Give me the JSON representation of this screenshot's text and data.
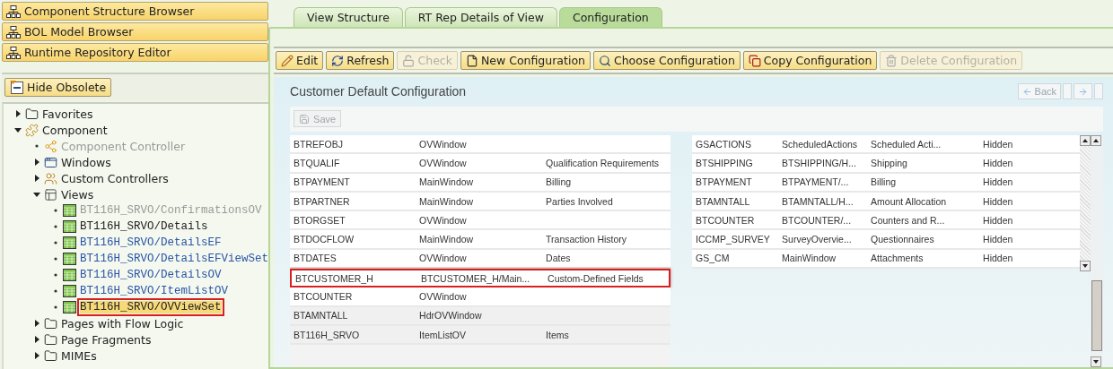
{
  "nav_buttons": [
    {
      "label": "Component Structure Browser"
    },
    {
      "label": "BOL Model Browser"
    },
    {
      "label": "Runtime Repository Editor"
    }
  ],
  "hide_obsolete": {
    "label": "Hide Obsolete"
  },
  "tree": [
    {
      "label": "Favorites",
      "kind": "folder",
      "expanded": false
    },
    {
      "label": "Component",
      "kind": "component",
      "expanded": true,
      "children": [
        {
          "label": "Component Controller",
          "kind": "controller",
          "disabled": true
        },
        {
          "label": "Windows",
          "kind": "windows",
          "expanded": false
        },
        {
          "label": "Custom Controllers",
          "kind": "custom",
          "expanded": false
        },
        {
          "label": "Views",
          "kind": "views",
          "expanded": true,
          "children": [
            {
              "label": "BT116H_SRVO/ConfirmationsOV",
              "kind": "view",
              "disabled": true,
              "link": false,
              "selected": false
            },
            {
              "label": "BT116H_SRVO/Details",
              "kind": "view",
              "disabled": false,
              "link": false,
              "selected": false
            },
            {
              "label": "BT116H_SRVO/DetailsEF",
              "kind": "view",
              "disabled": false,
              "link": true,
              "selected": false
            },
            {
              "label": "BT116H_SRVO/DetailsEFViewSet",
              "kind": "view",
              "disabled": false,
              "link": true,
              "selected": false
            },
            {
              "label": "BT116H_SRVO/DetailsOV",
              "kind": "view",
              "disabled": false,
              "link": true,
              "selected": false
            },
            {
              "label": "BT116H_SRVO/ItemListOV",
              "kind": "view",
              "disabled": false,
              "link": true,
              "selected": false
            },
            {
              "label": "BT116H_SRVO/OVViewSet",
              "kind": "view",
              "disabled": false,
              "link": false,
              "selected": true
            }
          ]
        },
        {
          "label": "Pages with Flow Logic",
          "kind": "folder",
          "expanded": false
        },
        {
          "label": "Page Fragments",
          "kind": "folder",
          "expanded": false
        },
        {
          "label": "MIMEs",
          "kind": "folder",
          "expanded": false
        }
      ]
    }
  ],
  "tabs": [
    {
      "label": "View Structure",
      "selected": false
    },
    {
      "label": "RT Rep Details of View",
      "selected": false
    },
    {
      "label": "Configuration",
      "selected": true
    }
  ],
  "toolbar": [
    {
      "label": "Edit",
      "kind": "edit",
      "disabled": false
    },
    {
      "label": "Refresh",
      "kind": "refresh",
      "disabled": false
    },
    {
      "label": "Check",
      "kind": "check",
      "disabled": true
    },
    {
      "label": "New Configuration",
      "kind": "new",
      "disabled": false
    },
    {
      "label": "Choose Configuration",
      "kind": "choose",
      "disabled": false
    },
    {
      "label": "Copy Configuration",
      "kind": "copy",
      "disabled": false
    },
    {
      "label": "Delete Configuration",
      "kind": "delete",
      "disabled": true
    }
  ],
  "config_title": "Customer Default Configuration",
  "history": {
    "back": "Back"
  },
  "save": {
    "label": "Save",
    "disabled": true
  },
  "left_table": {
    "rows": [
      {
        "cells": [
          "BTREFOBJ",
          "OVWindow",
          ""
        ],
        "highlighted": false
      },
      {
        "cells": [
          "BTQUALIF",
          "OVWindow",
          "Qualification Requirements"
        ],
        "highlighted": false
      },
      {
        "cells": [
          "BTPAYMENT",
          "MainWindow",
          "Billing"
        ],
        "highlighted": false
      },
      {
        "cells": [
          "BTPARTNER",
          "MainWindow",
          "Parties Involved"
        ],
        "highlighted": false
      },
      {
        "cells": [
          "BTORGSET",
          "OVWindow",
          ""
        ],
        "highlighted": false
      },
      {
        "cells": [
          "BTDOCFLOW",
          "MainWindow",
          "Transaction History"
        ],
        "highlighted": false
      },
      {
        "cells": [
          "BTDATES",
          "OVWindow",
          "Dates"
        ],
        "highlighted": false
      },
      {
        "cells": [
          "BTCUSTOMER_H",
          "BTCUSTOMER_H/Main...",
          "Custom-Defined Fields"
        ],
        "highlighted": true
      },
      {
        "cells": [
          "BTCOUNTER",
          "OVWindow",
          ""
        ],
        "highlighted": false
      },
      {
        "cells": [
          "BTAMNTALL",
          "HdrOVWindow",
          ""
        ],
        "highlighted": false
      },
      {
        "cells": [
          "BT116H_SRVO",
          "ItemListOV",
          "Items"
        ],
        "highlighted": false
      }
    ]
  },
  "right_table": {
    "rows": [
      {
        "cells": [
          "GSACTIONS",
          "ScheduledActions",
          "Scheduled Acti...",
          "Hidden"
        ]
      },
      {
        "cells": [
          "BTSHIPPING",
          "BTSHIPPING/H...",
          "Shipping",
          "Hidden"
        ]
      },
      {
        "cells": [
          "BTPAYMENT",
          "BTPAYMENT/...",
          "Billing",
          "Hidden"
        ]
      },
      {
        "cells": [
          "BTAMNTALL",
          "BTAMNTALL/H...",
          "Amount Allocation",
          "Hidden"
        ]
      },
      {
        "cells": [
          "BTCOUNTER",
          "BTCOUNTER/...",
          "Counters and R...",
          "Hidden"
        ]
      },
      {
        "cells": [
          "ICCMP_SURVEY",
          "SurveyOvervie...",
          "Questionnaires",
          "Hidden"
        ]
      },
      {
        "cells": [
          "GS_CM",
          "MainWindow",
          "Attachments",
          "Hidden"
        ]
      }
    ]
  }
}
